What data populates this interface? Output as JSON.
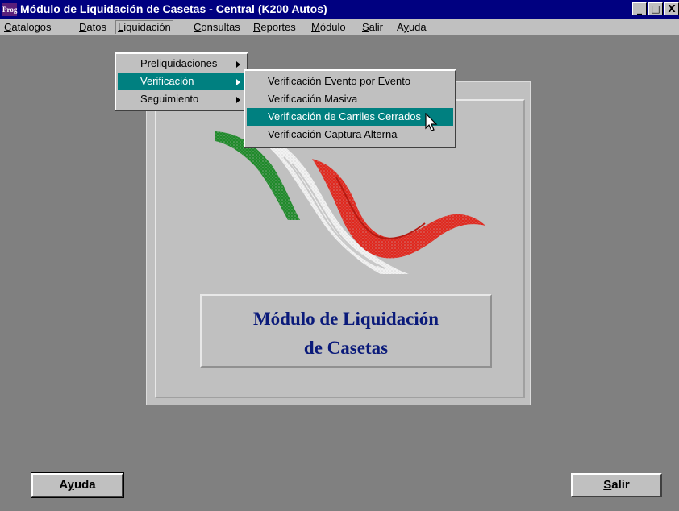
{
  "window": {
    "icon_text": "Prog",
    "title": "Módulo de Liquidación de Casetas - Central (K200 Autos)",
    "buttons": [
      "_",
      "□",
      "X"
    ]
  },
  "menubar": {
    "items": [
      {
        "label": "Catalogos",
        "accel": "C"
      },
      {
        "label": "Datos",
        "accel": "D"
      },
      {
        "label": "Liquidación",
        "accel": "L"
      },
      {
        "label": "Consultas",
        "accel": "C"
      },
      {
        "label": "Reportes",
        "accel": "R"
      },
      {
        "label": "Módulo",
        "accel": "M"
      },
      {
        "label": "Salir",
        "accel": "S"
      },
      {
        "label": "Ayuda",
        "accel": "y"
      }
    ]
  },
  "liquidacion_menu": {
    "items": [
      {
        "label": "Preliquidaciones",
        "has_submenu": true
      },
      {
        "label": "Verificación",
        "has_submenu": true,
        "highlighted": true
      },
      {
        "label": "Seguimiento",
        "has_submenu": true
      }
    ]
  },
  "verificacion_submenu": {
    "items": [
      {
        "label": "Verificación Evento por Evento"
      },
      {
        "label": "Verificación Masiva"
      },
      {
        "label": "Verificación de Carriles Cerrados",
        "highlighted": true
      },
      {
        "label": "Verificación Captura Alterna"
      }
    ]
  },
  "panel": {
    "title_line1": "Módulo de Liquidación",
    "title_line2": "de Casetas"
  },
  "buttons": {
    "ayuda": "Ayuda",
    "salir": "Salir"
  },
  "colors": {
    "titlebar": "#000080",
    "menu_highlight": "#008080",
    "logo_green": "#1f8a2a",
    "logo_white": "#f2f2f2",
    "logo_red": "#e0281e",
    "title_text": "#0a1a7a"
  }
}
